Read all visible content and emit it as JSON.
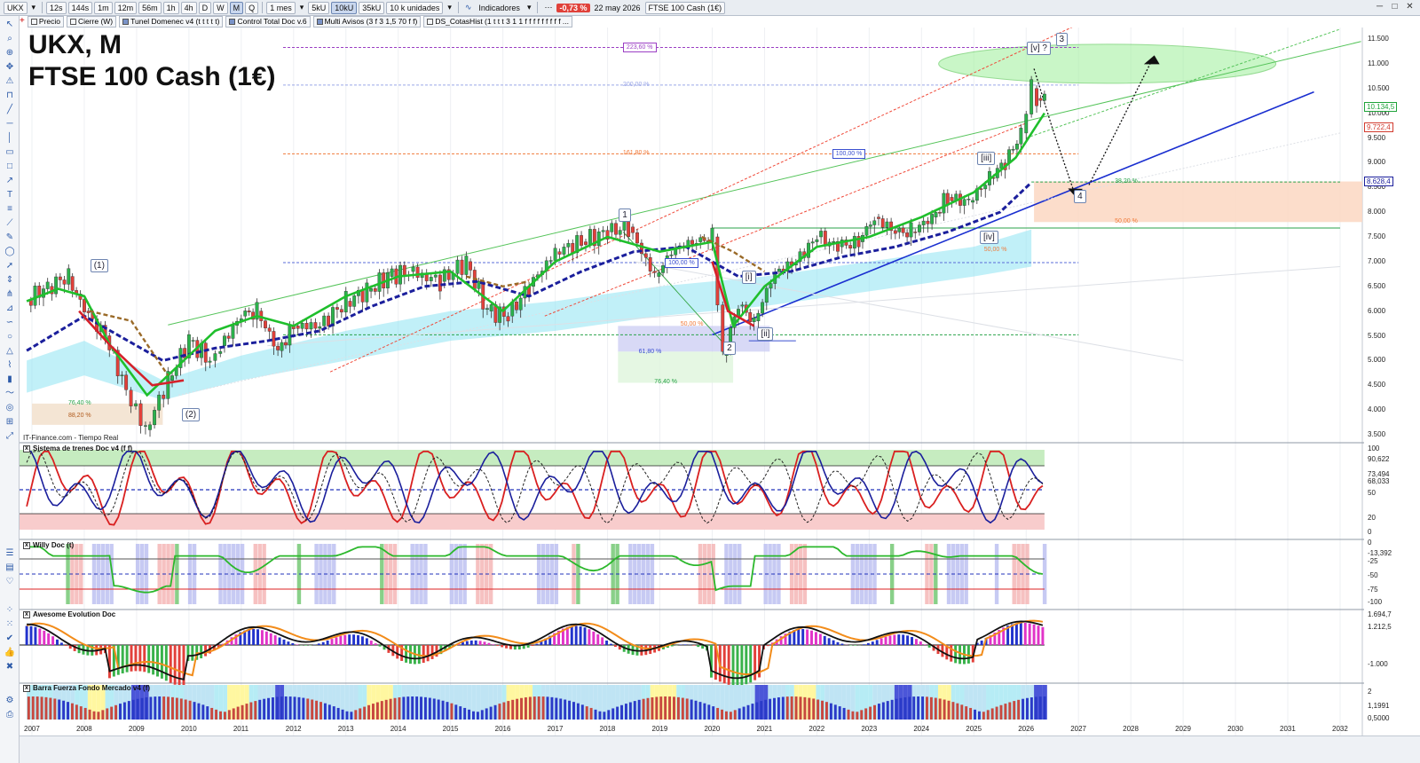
{
  "toolbar": {
    "symbol": "UKX",
    "timeframes": [
      "12s",
      "144s",
      "1m",
      "12m",
      "56m",
      "1h",
      "4h",
      "D",
      "W",
      "M",
      "Q"
    ],
    "active_timeframe": "M",
    "period": "1 mes",
    "ticks": [
      "5kU",
      "10kU",
      "35kU"
    ],
    "active_tick": "10kU",
    "units": "10 k unidades",
    "indicators_label": "Indicadores",
    "change": "-0,73 %",
    "date": "22 may 2026",
    "instrument": "FTSE 100 Cash (1€)"
  },
  "indicator_chips": [
    "Precio",
    "Cierre (W)",
    "Tunel Domenec v4 (t t t t t)",
    "Control Total Doc v.6",
    "Multi Avisos (3 f 3 1,5 70 f f)",
    "DS_CotasHist (1 t t t 3 1 1 f f f f f f f f f ..."
  ],
  "chart_title_line1": "UKX, M",
  "chart_title_line2": "FTSE 100 Cash (1€)",
  "source": "IT-Finance.com - Tiempo Real",
  "colors": {
    "up_candle": "#2bb24c",
    "down_candle": "#e2403a",
    "ema_fast": "#1fbf2c",
    "ema_slow": "#1b1f9c",
    "band": "#8ee4f2",
    "trend_blue": "#1a2fd0",
    "target_ellipse": "#9ef09a",
    "fib_purple": "#9b3fc4",
    "fib_orange": "#f07a3a",
    "fib_green": "#2aa34a",
    "support_zone": "#fbd7c2"
  },
  "chart_data": {
    "type": "candlestick",
    "title": "UKX, M — FTSE 100 Cash (1€)",
    "x_axis": {
      "labels": [
        "2007",
        "2008",
        "2009",
        "2010",
        "2011",
        "2012",
        "2013",
        "2014",
        "2015",
        "2016",
        "2017",
        "2018",
        "2019",
        "2020",
        "2021",
        "2022",
        "2023",
        "2024",
        "2025",
        "2026",
        "2027",
        "2028",
        "2029",
        "2030",
        "2031",
        "2032"
      ]
    },
    "y_axis": {
      "ticks": [
        "11.500",
        "11.000",
        "10.500",
        "10.000",
        "9.500",
        "9.000",
        "8.500",
        "8.000",
        "7.500",
        "7.000",
        "6.500",
        "6.000",
        "5.500",
        "5.000",
        "4.500",
        "4.000",
        "3.500"
      ],
      "range": [
        3300,
        11800
      ]
    },
    "price_series": {
      "x": [
        2006.9,
        2007.3,
        2007.7,
        2008.0,
        2008.4,
        2008.8,
        2009.17,
        2009.6,
        2010.0,
        2010.4,
        2010.6,
        2011.0,
        2011.3,
        2011.7,
        2012.0,
        2012.5,
        2013.0,
        2013.4,
        2013.8,
        2014.2,
        2014.8,
        2015.3,
        2015.7,
        2016.1,
        2016.5,
        2017.0,
        2017.5,
        2018.0,
        2018.4,
        2018.9,
        2019.3,
        2019.7,
        2020.0,
        2020.2,
        2020.5,
        2020.8,
        2021.2,
        2021.6,
        2022.0,
        2022.4,
        2022.8,
        2023.1,
        2023.5,
        2023.8,
        2024.2,
        2024.5,
        2024.9,
        2025.3,
        2025.6,
        2025.9,
        2026.1,
        2026.2,
        2026.35
      ],
      "close": [
        6220,
        6500,
        6700,
        6000,
        5500,
        4400,
        3600,
        4600,
        5400,
        5000,
        5300,
        5900,
        6000,
        5200,
        5700,
        5700,
        6200,
        6400,
        6700,
        6800,
        6600,
        7000,
        6000,
        5900,
        6500,
        7200,
        7400,
        7600,
        7700,
        6700,
        7300,
        7400,
        7500,
        5100,
        6100,
        5800,
        6800,
        7000,
        7500,
        7300,
        7400,
        7900,
        7600,
        7600,
        7900,
        8300,
        8200,
        8700,
        9000,
        9600,
        10500,
        10300,
        10350
      ]
    },
    "ema_fast": {
      "x": [
        2006.9,
        2007.5,
        2008.0,
        2008.5,
        2009.2,
        2009.8,
        2010.5,
        2011.3,
        2012.0,
        2013.0,
        2014.0,
        2015.0,
        2016.0,
        2017.0,
        2018.0,
        2019.0,
        2020.0,
        2020.4,
        2021.0,
        2022.0,
        2023.0,
        2024.0,
        2025.0,
        2025.8,
        2026.35
      ],
      "y": [
        6200,
        6450,
        6300,
        5300,
        4300,
        4900,
        5600,
        5900,
        5700,
        6300,
        6700,
        6800,
        6000,
        7000,
        7500,
        7200,
        7400,
        5700,
        6500,
        7300,
        7500,
        7900,
        8400,
        9100,
        10000
      ]
    },
    "ema_slow": {
      "x": [
        2006.9,
        2008.0,
        2009.5,
        2010.5,
        2011.5,
        2012.5,
        2013.5,
        2014.5,
        2015.5,
        2016.5,
        2017.5,
        2018.5,
        2019.5,
        2020.5,
        2021.5,
        2022.5,
        2023.5,
        2024.5,
        2025.5,
        2026.1
      ],
      "y": [
        5200,
        5900,
        5000,
        5250,
        5400,
        5600,
        6100,
        6500,
        6600,
        6300,
        6800,
        7200,
        7300,
        6700,
        6800,
        7100,
        7300,
        7600,
        8000,
        8600
      ]
    },
    "series": [
      {
        "name": "Tunel Domenec v4 (t t t t t)"
      },
      {
        "name": "Control Total Doc v.6"
      },
      {
        "name": "Multi Avisos (3 f 3 1,5 70 f f)"
      },
      {
        "name": "DS_CotasHist (1 t t t 3 1 1 f f f f f f f f f ..."
      }
    ],
    "annotations": {
      "wave_labels": [
        {
          "label": "(1)",
          "x": 2008.25,
          "y": 6920
        },
        {
          "label": "(2)",
          "x": 2010.0,
          "y": 3920
        },
        {
          "label": "1",
          "x": 2018.35,
          "y": 7950
        },
        {
          "label": "2",
          "x": 2020.35,
          "y": 5250
        },
        {
          "label": "[i]",
          "x": 2020.7,
          "y": 6700
        },
        {
          "label": "[ii]",
          "x": 2021.0,
          "y": 5550
        },
        {
          "label": "[iii]",
          "x": 2025.2,
          "y": 9100
        },
        {
          "label": "[iv]",
          "x": 2025.25,
          "y": 7500
        },
        {
          "label": "[v] ?",
          "x": 2026.15,
          "y": 11320
        },
        {
          "label": "3",
          "x": 2026.7,
          "y": 11500
        },
        {
          "label": "4",
          "x": 2027.05,
          "y": 8330
        }
      ],
      "fib_levels": [
        {
          "label": "223,60 %",
          "y": 11330,
          "color": "#9b3fc4"
        },
        {
          "label": "200,00 %",
          "y": 10570,
          "color": "#9aa6e6"
        },
        {
          "label": "161,80 %",
          "y": 9180,
          "color": "#f07a3a"
        },
        {
          "label": "100,00 %",
          "y": 9180,
          "color": "#3a4fd0"
        },
        {
          "label": "100,00 %",
          "y": 6980,
          "color": "#3a4fd0"
        },
        {
          "label": "38,20 %",
          "y": 8610,
          "color": "#2aa34a"
        },
        {
          "label": "50,00 %",
          "y": 7800,
          "color": "#f07a3a"
        },
        {
          "label": "50,00 %",
          "y": 5720,
          "color": "#f07a3a"
        },
        {
          "label": "61,80 %",
          "y": 5160,
          "color": "#3a4fd0"
        },
        {
          "label": "76,40 %",
          "y": 4550,
          "color": "#2aa34a"
        },
        {
          "label": "76,40 %",
          "y": 4130,
          "color": "#2aa34a"
        },
        {
          "label": "88,20 %",
          "y": 3870,
          "color": "#b05a1c"
        },
        {
          "label": "50,00 %",
          "y": 7230,
          "color": "#f07a3a"
        }
      ],
      "price_tags": [
        {
          "label": "10.134,5",
          "y": 10134,
          "color": "#1fa33a"
        },
        {
          "label": "9.722,4",
          "y": 9722,
          "color": "#d23b2f"
        },
        {
          "label": "8.628,4",
          "y": 8628,
          "color": "#1b1f9c"
        }
      ]
    }
  },
  "panes": [
    {
      "title": "Sistema de trenes Doc v4 (f f)",
      "ticks": [
        "100",
        "90,622",
        "73,494",
        "68,033",
        "50",
        "20",
        "0"
      ]
    },
    {
      "title": "Willy Doc (t)",
      "ticks": [
        "0",
        "-13,392",
        "-25",
        "-50",
        "-75",
        "-100"
      ]
    },
    {
      "title": "Awesome Evolution Doc",
      "ticks": [
        "1.694,7",
        "1.212,5",
        "-1.000"
      ]
    },
    {
      "title": "Barra Fuerza Fondo Mercado v4 (f)",
      "ticks": [
        "2",
        "1,1991",
        "0,5000"
      ]
    }
  ]
}
